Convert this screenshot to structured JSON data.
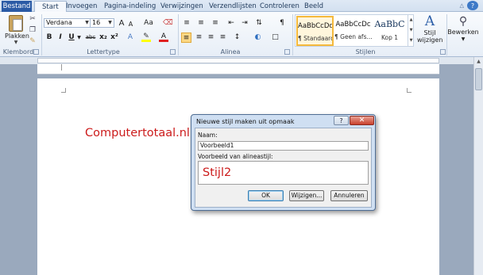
{
  "tabs": {
    "file": "Bestand",
    "items": [
      "Start",
      "Invoegen",
      "Pagina-indeling",
      "Verwijzingen",
      "Verzendlijsten",
      "Controleren",
      "Beeld"
    ]
  },
  "clipboard": {
    "paste_label": "Plakken",
    "group_label": "Klembord"
  },
  "font": {
    "family": "Verdana",
    "size": "16",
    "group_label": "Lettertype",
    "buttons": {
      "grow": "A",
      "shrink": "A",
      "case": "Aa",
      "bold": "B",
      "italic": "I",
      "underline": "U",
      "strike": "abc",
      "subscript": "x₂",
      "superscript": "x²",
      "color": "A"
    }
  },
  "paragraph": {
    "group_label": "Alinea",
    "pilcrow": "¶"
  },
  "styles": {
    "group_label": "Stijlen",
    "items": [
      {
        "sample": "AaBbCcDc",
        "name": "¶ Standaard"
      },
      {
        "sample": "AaBbCcDc",
        "name": "¶ Geen afs..."
      },
      {
        "sample": "AaBbC",
        "name": "Kop 1"
      }
    ],
    "change_styles": "Stijl wijzigen"
  },
  "editing": {
    "label": "Bewerken"
  },
  "document": {
    "text": "Computertotaal.nl"
  },
  "dialog": {
    "title": "Nieuwe stijl maken uit opmaak",
    "help": "?",
    "close": "✕",
    "name_label": "Naam:",
    "name_value": "Voorbeeld1",
    "preview_label": "Voorbeeld van alineastijl:",
    "preview_text": "Stijl2",
    "ok": "OK",
    "modify": "Wijzigen...",
    "cancel": "Annuleren"
  },
  "colors": {
    "file_tab": "#2a5aa5",
    "doc_text": "#cc1b1b",
    "selected_style": "#f5b93c"
  }
}
